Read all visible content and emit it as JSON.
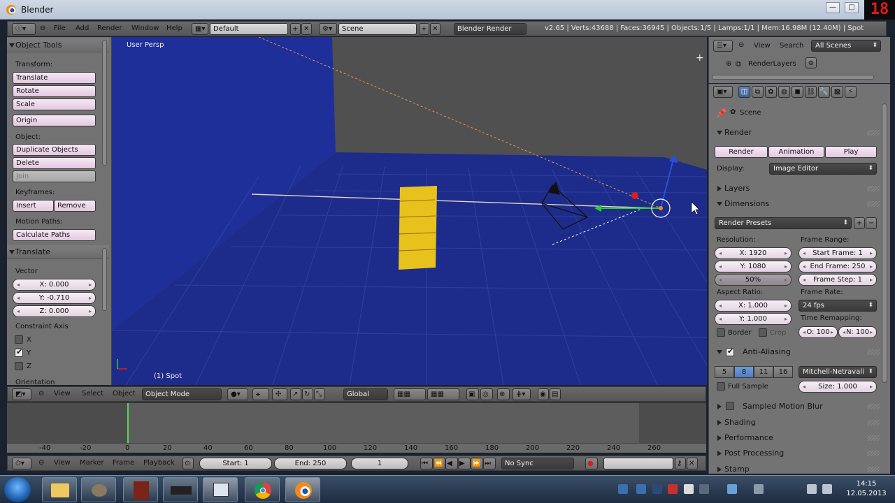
{
  "window": {
    "title": "Blender",
    "rec_digit": "18",
    "min": "—",
    "max": "□",
    "close": "✕"
  },
  "header": {
    "menus": [
      "File",
      "Add",
      "Render",
      "Window",
      "Help"
    ],
    "layout": "Default",
    "scene": "Scene",
    "engine": "Blender Render",
    "info": "v2.65 | Verts:43688 | Faces:36945 | Objects:1/5 | Lamps:1/1 | Mem:16.98M (12.40M) | Spot"
  },
  "toolshelf": {
    "title": "Object Tools",
    "transform_label": "Transform:",
    "translate": "Translate",
    "rotate": "Rotate",
    "scale": "Scale",
    "origin": "Origin",
    "object_label": "Object:",
    "duplicate": "Duplicate Objects",
    "delete": "Delete",
    "join": "Join",
    "keyframes_label": "Keyframes:",
    "insert": "Insert",
    "remove": "Remove",
    "motion_label": "Motion Paths:",
    "calculate": "Calculate Paths",
    "op_title": "Translate",
    "vector_label": "Vector",
    "x": "X: 0.000",
    "y": "Y: -0.710",
    "z": "Z: 0.000",
    "constraint_label": "Constraint Axis",
    "ax": "X",
    "ay": "Y",
    "az": "Z",
    "orientation_label": "Orientation"
  },
  "viewport": {
    "persp": "User Persp",
    "active": "(1) Spot",
    "header": {
      "view": "View",
      "select": "Select",
      "object": "Object",
      "mode": "Object Mode",
      "orientation": "Global"
    }
  },
  "timeline": {
    "ticks": [
      "-40",
      "-20",
      "0",
      "20",
      "40",
      "60",
      "80",
      "100",
      "120",
      "140",
      "160",
      "180",
      "200",
      "220",
      "240",
      "260"
    ],
    "menus": [
      "View",
      "Marker",
      "Frame",
      "Playback"
    ],
    "start": "Start: 1",
    "end": "End: 250",
    "current": "1",
    "sync": "No Sync"
  },
  "outliner": {
    "view": "View",
    "search": "Search",
    "filter": "All Scenes",
    "item": "RenderLayers"
  },
  "properties": {
    "context": "Scene",
    "render": {
      "title": "Render",
      "render": "Render",
      "animation": "Animation",
      "play": "Play",
      "display_label": "Display:",
      "display": "Image Editor"
    },
    "layers": "Layers",
    "dimensions": {
      "title": "Dimensions",
      "presets": "Render Presets",
      "resolution_label": "Resolution:",
      "res_x": "X: 1920",
      "res_y": "Y: 1080",
      "res_pct": "50%",
      "frame_range_label": "Frame Range:",
      "start": "Start Frame: 1",
      "end": "End Frame: 250",
      "step": "Frame Step: 1",
      "aspect_label": "Aspect Ratio:",
      "asp_x": "X: 1.000",
      "asp_y": "Y: 1.000",
      "frame_rate_label": "Frame Rate:",
      "fps": "24 fps",
      "remap_label": "Time Remapping:",
      "remap_old": "O: 100",
      "remap_new": "N: 100",
      "border": "Border",
      "crop": "Crop"
    },
    "aa": {
      "title": "Anti-Aliasing",
      "samples": [
        "5",
        "8",
        "11",
        "16"
      ],
      "filter": "Mitchell-Netravali",
      "full_sample": "Full Sample",
      "size": "Size: 1.000"
    },
    "collapsed": [
      "Sampled Motion Blur",
      "Shading",
      "Performance",
      "Post Processing",
      "Stamp"
    ]
  },
  "taskbar": {
    "time": "14:15",
    "date": "12.05.2013"
  }
}
